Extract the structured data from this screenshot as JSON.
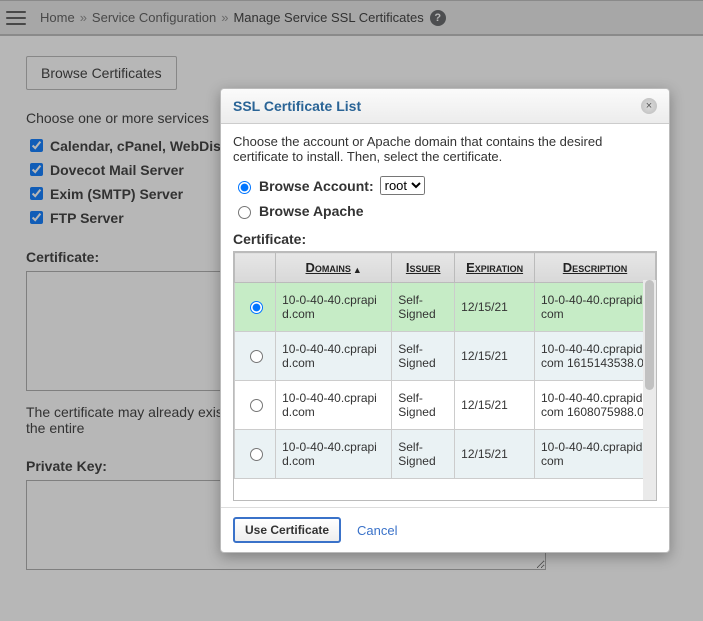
{
  "breadcrumb": {
    "items": [
      "Home",
      "Service Configuration",
      "Manage Service SSL Certificates"
    ],
    "help_glyph": "?"
  },
  "main": {
    "browse_btn": "Browse Certificates",
    "choose_text": "Choose one or more services",
    "services": [
      "Calendar, cPanel, WebDisk",
      "Dovecot Mail Server",
      "Exim (SMTP) Server",
      "FTP Server"
    ],
    "cert_label": "Certificate:",
    "cert_hint": "The certificate may already exist on the server. Browse for the certificate or paste the entire",
    "pkey_label": "Private Key:"
  },
  "dialog": {
    "title": "SSL Certificate List",
    "close_glyph": "×",
    "instr": "Choose the account or Apache domain that contains the desired certificate to install. Then, select the certificate.",
    "browse_account_label": "Browse Account:",
    "account_selected": "root",
    "browse_apache_label": "Browse Apache",
    "cert_heading": "Certificate:",
    "columns": {
      "domains": "Domains",
      "issuer": "Issuer",
      "expiration": "Expiration",
      "description": "Description"
    },
    "rows": [
      {
        "selected": true,
        "domain": "10-0-40-40.cprapid.com",
        "issuer": "Self-Signed",
        "expiration": "12/15/21",
        "description": "10-0-40-40.cprapid.com"
      },
      {
        "selected": false,
        "domain": "10-0-40-40.cprapid.com",
        "issuer": "Self-Signed",
        "expiration": "12/15/21",
        "description": "10-0-40-40.cprapid.com 1615143538.0"
      },
      {
        "selected": false,
        "domain": "10-0-40-40.cprapid.com",
        "issuer": "Self-Signed",
        "expiration": "12/15/21",
        "description": "10-0-40-40.cprapid.com 1608075988.0"
      },
      {
        "selected": false,
        "domain": "10-0-40-40.cprapid.com",
        "issuer": "Self-Signed",
        "expiration": "12/15/21",
        "description": "10-0-40-40.cprapid.com"
      }
    ],
    "use_btn": "Use Certificate",
    "cancel": "Cancel"
  }
}
